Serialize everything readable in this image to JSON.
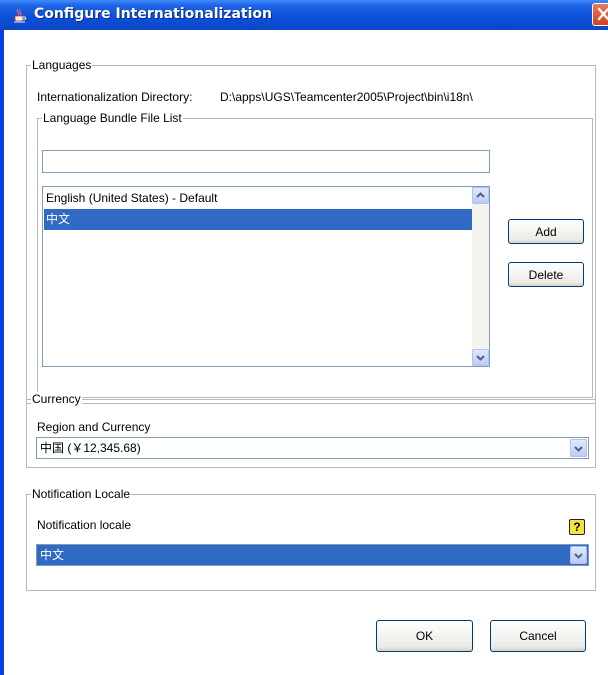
{
  "window": {
    "title": "Configure Internationalization",
    "title_icon": "java-coffee-cup-icon",
    "close_icon": "close-icon"
  },
  "languages": {
    "legend": "Languages",
    "dir_label": "Internationalization Directory:",
    "dir_value": "D:\\apps\\UGS\\Teamcenter2005\\Project\\bin\\i18n\\",
    "bundle_list": {
      "legend": "Language Bundle File List",
      "input_value": "",
      "items": [
        "English (United States) - Default",
        "中文"
      ],
      "selected_index": 1
    },
    "add_label": "Add",
    "delete_label": "Delete"
  },
  "currency": {
    "legend": "Currency",
    "region_label": "Region and Currency",
    "selected": "中国 (￥12,345.68)"
  },
  "notification": {
    "legend": "Notification Locale",
    "locale_label": "Notification locale",
    "help_glyph": "?",
    "selected": "中文"
  },
  "footer": {
    "ok_label": "OK",
    "cancel_label": "Cancel"
  },
  "colors": {
    "selection": "#316ac5",
    "titlebar": "#0a4fd8",
    "close_button": "#d3421f"
  }
}
